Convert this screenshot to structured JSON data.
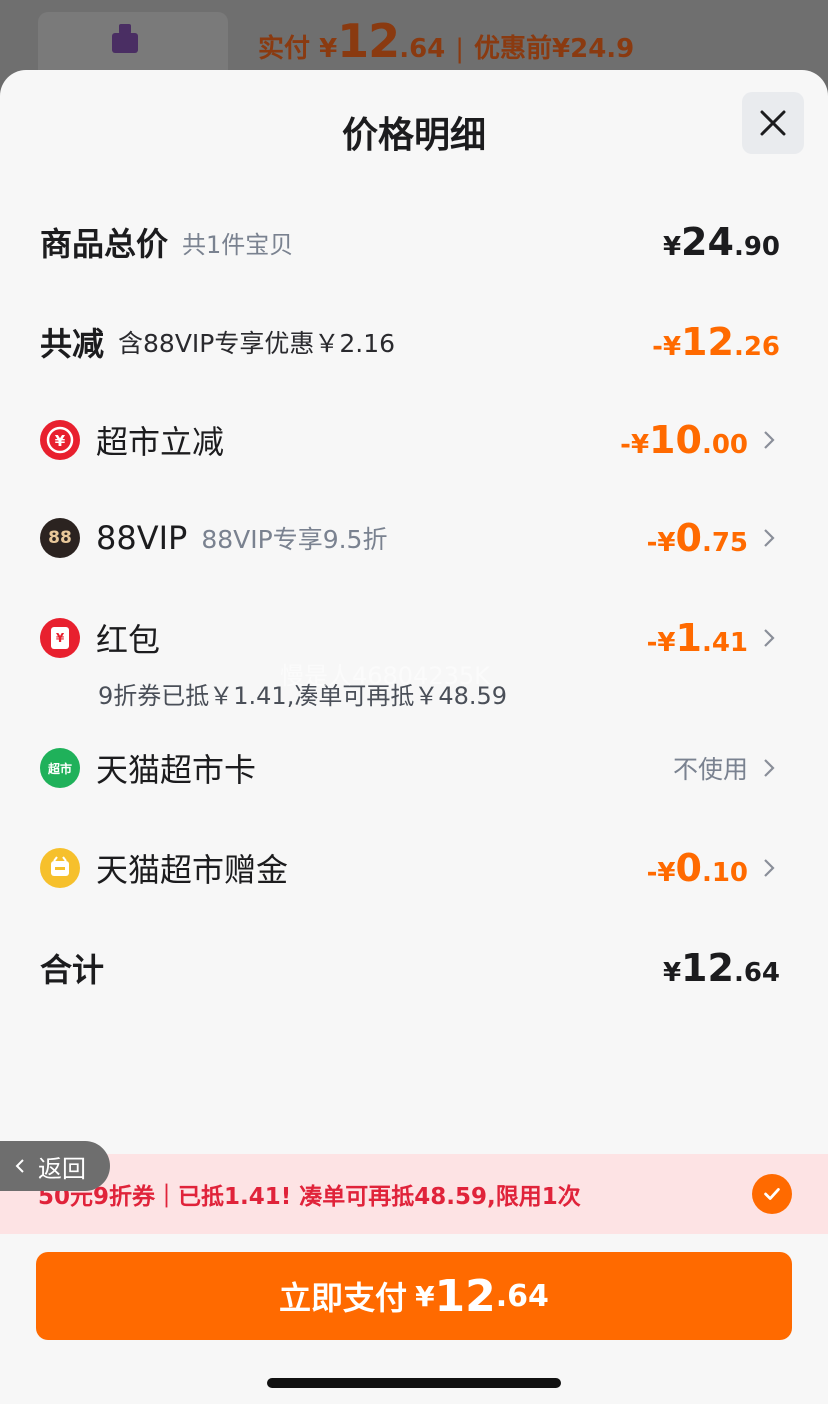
{
  "header": {
    "paid_label": "实付",
    "currency": "¥",
    "paid_int": "12",
    "paid_dec": ".64",
    "separator": "|",
    "before_label": "优惠前¥24.9"
  },
  "sheet": {
    "title": "价格明细",
    "close_icon": "close-icon"
  },
  "rows": {
    "total": {
      "label": "商品总价",
      "sub": "共1件宝贝",
      "cur": "¥",
      "int": "24",
      "dec": ".90"
    },
    "reduce": {
      "label": "共减",
      "sub": "含88VIP专享优惠￥2.16",
      "cur": "-¥",
      "int": "12",
      "dec": ".26"
    },
    "supermarket": {
      "label": "超市立减",
      "cur": "-¥",
      "int": "10",
      "dec": ".00",
      "icon": "yuan-coin-icon"
    },
    "vip": {
      "label": "88VIP",
      "sub": "88VIP专享9.5折",
      "cur": "-¥",
      "int": "0",
      "dec": ".75",
      "icon": "88vip-icon",
      "icon_text": "88"
    },
    "redpacket": {
      "label": "红包",
      "cur": "-¥",
      "int": "1",
      "dec": ".41",
      "icon": "red-packet-icon",
      "icon_text": "¥",
      "note": "9折券已抵￥1.41,凑单可再抵￥48.59"
    },
    "card": {
      "label": "天猫超市卡",
      "value": "不使用",
      "icon": "tmall-supermarket-card-icon",
      "icon_text": "超市"
    },
    "gift": {
      "label": "天猫超市赠金",
      "cur": "-¥",
      "int": "0",
      "dec": ".10",
      "icon": "gift-gold-icon"
    },
    "sum": {
      "label": "合计",
      "cur": "¥",
      "int": "12",
      "dec": ".64"
    }
  },
  "watermark": "慢是人46804235K",
  "banner": {
    "back_label": "返回",
    "text": "50元9折券｜已抵1.41! 凑单可再抵48.59,限用1次"
  },
  "pay_button": {
    "label": "立即支付",
    "cur": "¥",
    "int": "12",
    "dec": ".64"
  },
  "colors": {
    "accent": "#ff6a00",
    "banner_text": "#e0233a",
    "banner_bg": "#fde3e4"
  }
}
